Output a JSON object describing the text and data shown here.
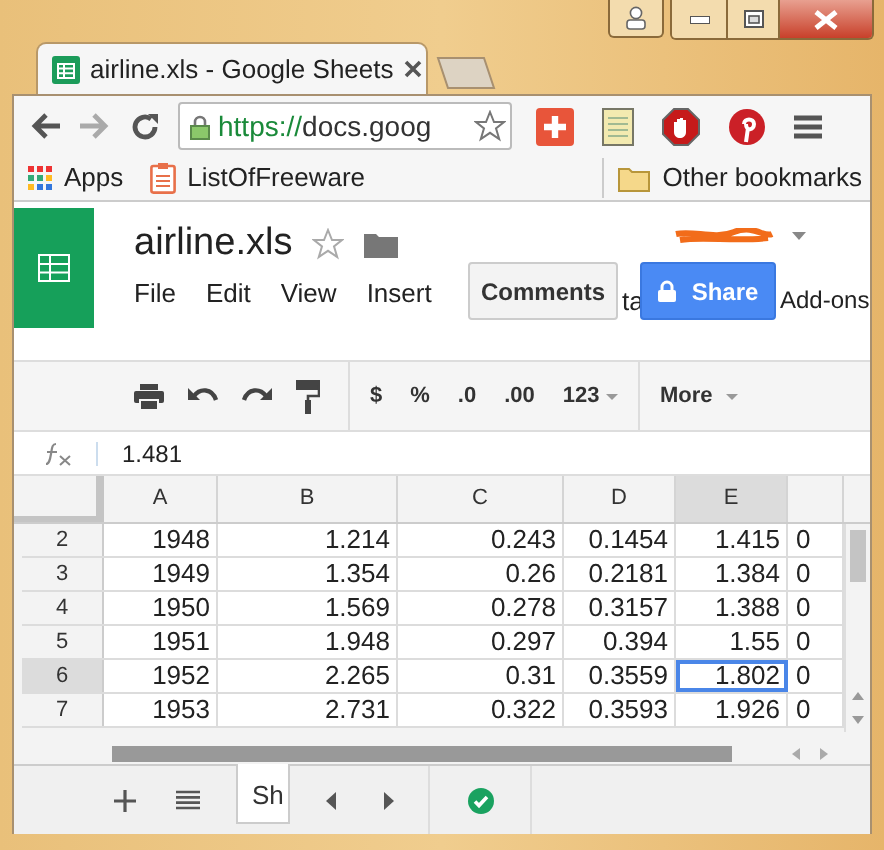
{
  "browser_tabs": [
    {
      "title": "airline.xls - Google Sheets",
      "selected": true
    }
  ],
  "address_bar": {
    "scheme": "https://",
    "rest": "docs.goog"
  },
  "bookmarks": [
    {
      "kind": "apps",
      "label": "Apps"
    },
    {
      "kind": "page",
      "label": "ListOfFreeware"
    },
    {
      "kind": "folder",
      "label": "Other bookmarks"
    }
  ],
  "document": {
    "title": "airline.xls",
    "starred": false
  },
  "menu": [
    "File",
    "Edit",
    "View",
    "Insert",
    "ta",
    "Add-ons"
  ],
  "comments_button": "Comments",
  "share_button": "Share",
  "format_buttons": [
    "$",
    "%",
    ".0",
    ".00",
    "123"
  ],
  "more_button": "More",
  "formula_bar": {
    "value": "1.481"
  },
  "columns": [
    {
      "label": "A",
      "selected": false
    },
    {
      "label": "B",
      "selected": false
    },
    {
      "label": "C",
      "selected": false
    },
    {
      "label": "D",
      "selected": false
    },
    {
      "label": "E",
      "selected": true
    }
  ],
  "rows": [
    {
      "header": "2",
      "selected": false,
      "cells": [
        "1948",
        "1.214",
        "0.243",
        "0.1454",
        "1.415",
        "0"
      ]
    },
    {
      "header": "3",
      "selected": false,
      "cells": [
        "1949",
        "1.354",
        "0.26",
        "0.2181",
        "1.384",
        "0"
      ]
    },
    {
      "header": "4",
      "selected": false,
      "cells": [
        "1950",
        "1.569",
        "0.278",
        "0.3157",
        "1.388",
        "0"
      ]
    },
    {
      "header": "5",
      "selected": false,
      "cells": [
        "1951",
        "1.948",
        "0.297",
        "0.394",
        "1.55",
        "0"
      ]
    },
    {
      "header": "6",
      "selected": true,
      "cells": [
        "1952",
        "2.265",
        "0.31",
        "0.3559",
        "1.802",
        "0"
      ]
    },
    {
      "header": "7",
      "selected": false,
      "cells": [
        "1953",
        "2.731",
        "0.322",
        "0.3593",
        "1.926",
        "0"
      ]
    }
  ],
  "sheet_tabs": [
    {
      "label": "Sh",
      "selected": true
    }
  ]
}
